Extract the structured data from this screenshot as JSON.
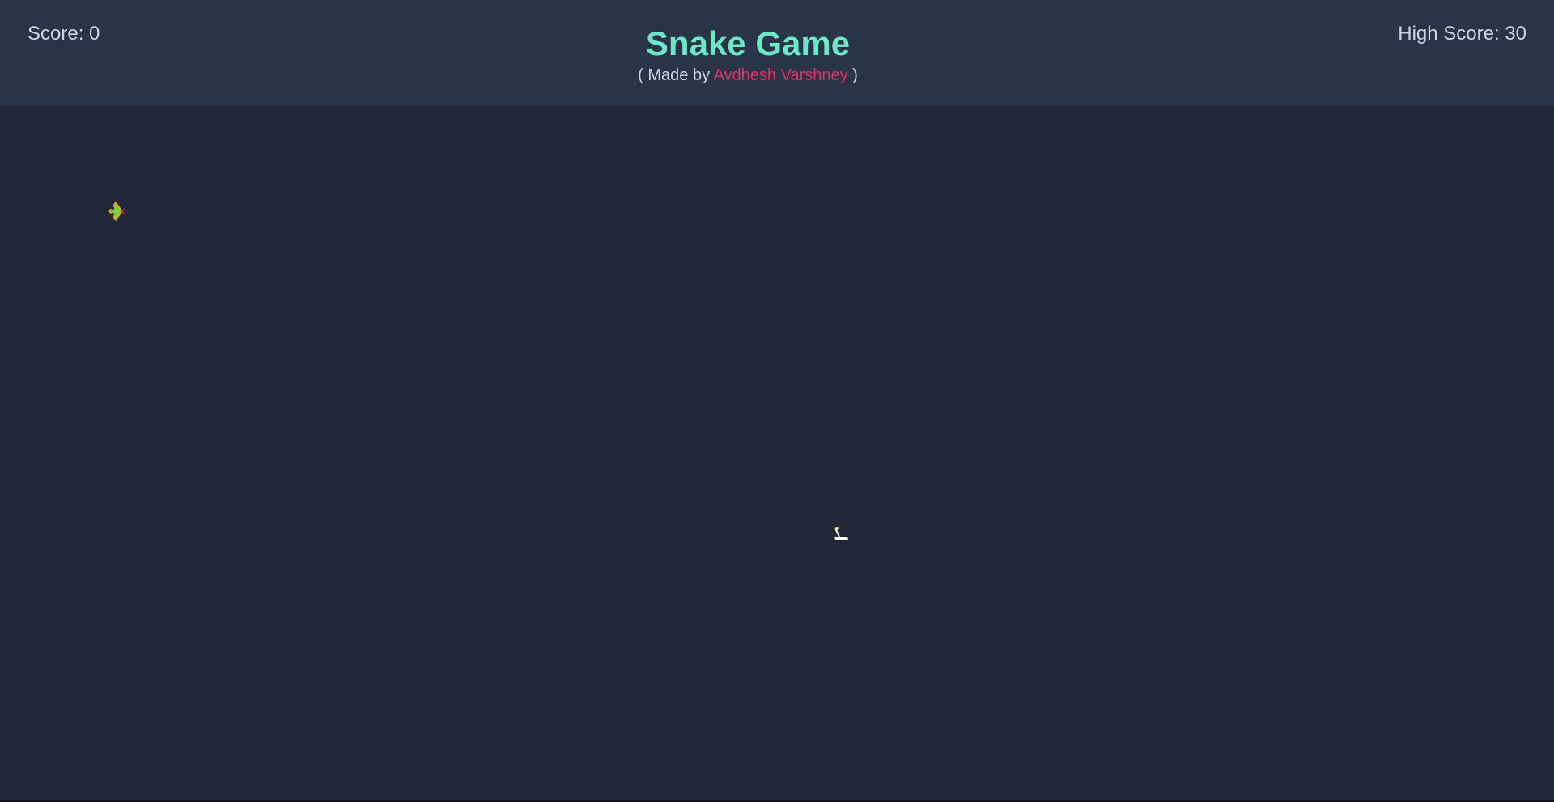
{
  "header": {
    "score_text": "Score: 0",
    "high_score_text": "High Score: 30",
    "title": "Snake Game",
    "subtitle_prefix": "( Made by ",
    "author": "Avdhesh Varshney",
    "subtitle_suffix": " )"
  },
  "game": {
    "snake_head_icon": "snake-head-icon",
    "food_icon": "swan-food-icon"
  },
  "colors": {
    "title": "#6ee7c7",
    "author": "#e0306a",
    "header_bg": "#2a3447",
    "board_bg": "#222838",
    "text": "#cbd5e1"
  }
}
